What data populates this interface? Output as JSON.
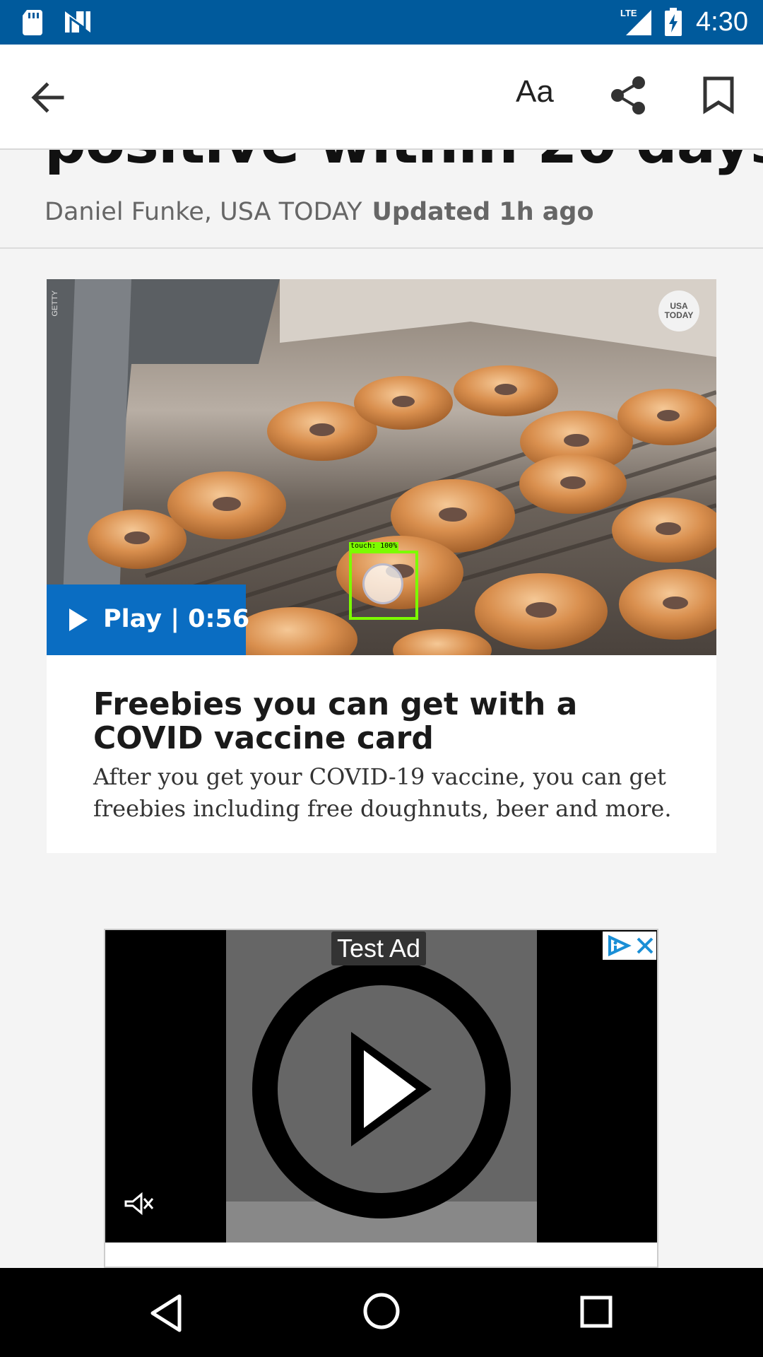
{
  "status_bar": {
    "time": "4:30",
    "network": "LTE",
    "icons": [
      "sd-card-icon",
      "n-icon",
      "lte-signal-icon",
      "battery-charging-icon"
    ]
  },
  "app_bar": {
    "text_size_label": "Aa",
    "icons": [
      "back-arrow-icon",
      "share-icon",
      "bookmark-icon"
    ]
  },
  "article": {
    "headline_visible_tail": "positive within 20 days",
    "author": "Daniel Funke, USA TODAY",
    "updated": "Updated 1h ago"
  },
  "video": {
    "watermark": "GETTY",
    "logo_text": "USA TODAY",
    "play_label": "Play | 0:56",
    "touch_label": "touch: 100%",
    "title": "Freebies you can get with a COVID vaccine card",
    "description": "After you get your COVID-19 vaccine, you can get freebies including free doughnuts, beer and more."
  },
  "ad": {
    "label": "Test Ad",
    "icons": [
      "adchoices-icon",
      "close-icon",
      "play-circle-icon",
      "mute-icon"
    ]
  },
  "nav_bar": {
    "icons": [
      "nav-back-icon",
      "nav-home-icon",
      "nav-recents-icon"
    ]
  }
}
